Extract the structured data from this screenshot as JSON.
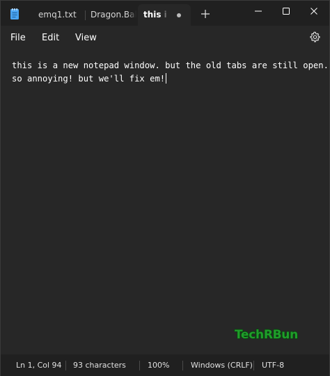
{
  "tabs": [
    {
      "label": "emq1.txt"
    },
    {
      "label": "Dragon.Ball.Super"
    },
    {
      "label": "this is a new"
    }
  ],
  "window_controls": {
    "minimize": "minimize",
    "maximize": "maximize",
    "close": "close"
  },
  "menu": {
    "file": "File",
    "edit": "Edit",
    "view": "View"
  },
  "editor": {
    "lines": [
      "this is a new notepad window. but the old tabs are still open.",
      "so annoying! but we'll fix em!"
    ]
  },
  "watermark": "TechRBun",
  "status": {
    "position": "Ln 1, Col 94",
    "characters": "93 characters",
    "zoom": "100%",
    "line_ending": "Windows (CRLF)",
    "encoding": "UTF-8"
  },
  "colors": {
    "background": "#272727",
    "titlebar": "#202020",
    "text": "#ffffff",
    "app_icon": "#4aa3f0",
    "watermark": "#1f9e2a"
  },
  "icons": [
    "notepad-app-icon",
    "unsaved-dot-icon",
    "plus-icon",
    "minimize-icon",
    "maximize-icon",
    "close-icon",
    "gear-icon"
  ]
}
